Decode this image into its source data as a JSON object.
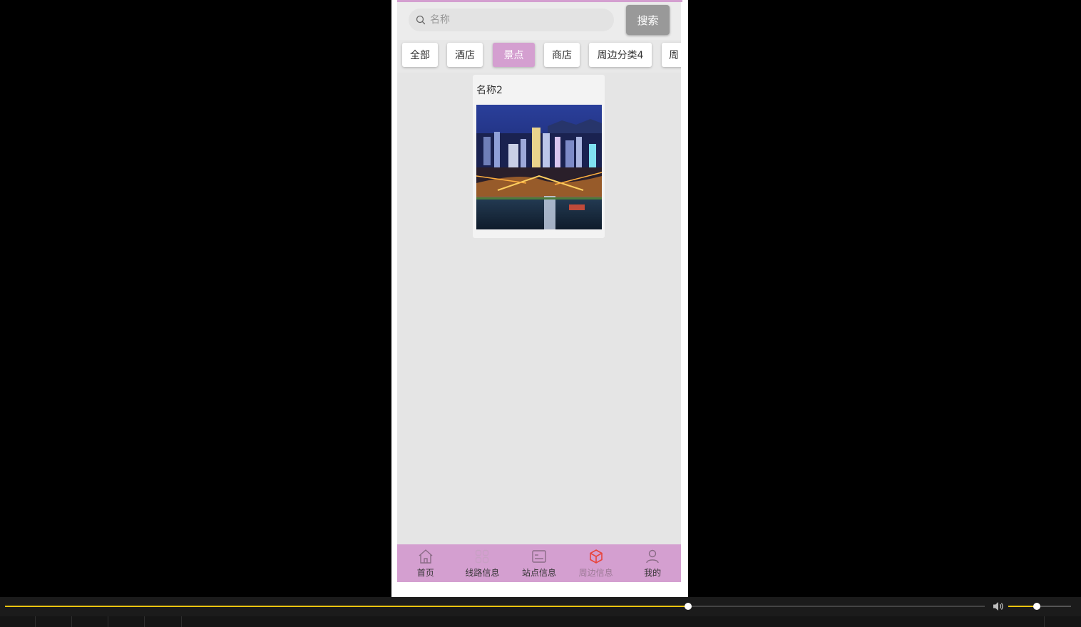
{
  "search": {
    "placeholder": "名称",
    "button_label": "搜索"
  },
  "categories": {
    "items": [
      "全部",
      "酒店",
      "景点",
      "商店",
      "周边分类4",
      "周"
    ],
    "active": "景点"
  },
  "results": [
    {
      "title": "名称2",
      "image": "city-night-skyline-photo"
    }
  ],
  "bottom_nav": {
    "items": [
      {
        "label": "首页",
        "icon": "home-icon"
      },
      {
        "label": "线路信息",
        "icon": "grid-icon"
      },
      {
        "label": "站点信息",
        "icon": "id-card-icon"
      },
      {
        "label": "周边信息",
        "icon": "cube-icon"
      },
      {
        "label": "我的",
        "icon": "user-icon"
      }
    ],
    "active": "周边信息"
  },
  "player": {
    "progress": 0.697,
    "volume": 0.45
  },
  "colors": {
    "accent": "#d49fd0",
    "search_button": "#999999",
    "active_icon": "#e8453c",
    "progress": "#f1c40f"
  }
}
